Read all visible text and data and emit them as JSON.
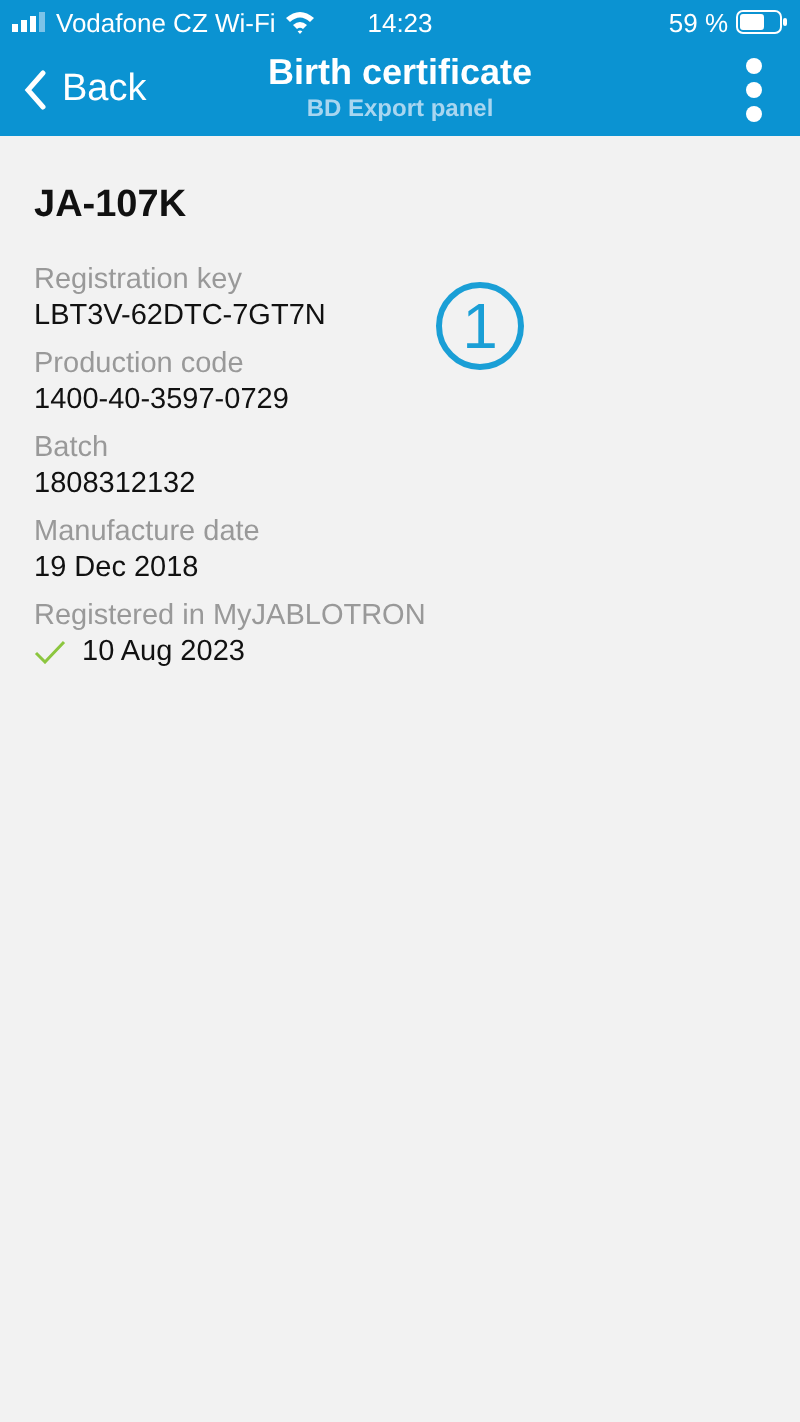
{
  "status_bar": {
    "carrier": "Vodafone CZ Wi-Fi",
    "time": "14:23",
    "battery": "59 %"
  },
  "nav": {
    "back": "Back",
    "title": "Birth certificate",
    "subtitle": "BD Export panel"
  },
  "device": {
    "name": "JA-107K"
  },
  "fields": [
    {
      "label": "Registration key",
      "value": "LBT3V-62DTC-7GT7N",
      "verified": false
    },
    {
      "label": "Production code",
      "value": "1400-40-3597-0729",
      "verified": false
    },
    {
      "label": "Batch",
      "value": "1808312132",
      "verified": false
    },
    {
      "label": "Manufacture date",
      "value": "19 Dec 2018",
      "verified": false
    },
    {
      "label": "Registered in MyJABLOTRON",
      "value": "10 Aug 2023",
      "verified": true
    }
  ],
  "callout": {
    "number": "1"
  }
}
